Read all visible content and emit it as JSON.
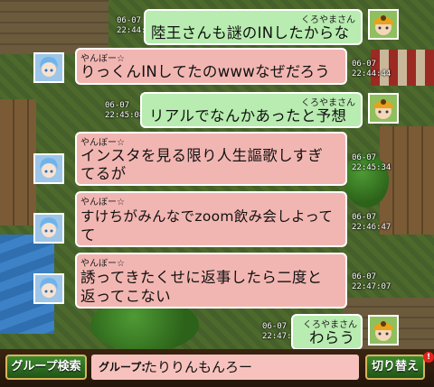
{
  "chat": {
    "messages": [
      {
        "side": "right",
        "sender": "くろやまさん",
        "date": "06-07",
        "time": "22:44:10",
        "lines": [
          "陸王さんも謎のINしたからな"
        ]
      },
      {
        "side": "left",
        "sender": "やんぼー☆",
        "date": "06-07",
        "time": "22:44:44",
        "lines": [
          "りっくんINしてたのwwwなぜだろう"
        ]
      },
      {
        "side": "right",
        "sender": "くろやまさん",
        "date": "06-07",
        "time": "22:45:08",
        "lines": [
          "リアルでなんかあったと予想"
        ]
      },
      {
        "side": "left",
        "sender": "やんぼー☆",
        "date": "06-07",
        "time": "22:45:34",
        "lines": [
          "インスタを見る限り人生謳歌しすぎ",
          "てるが"
        ]
      },
      {
        "side": "left",
        "sender": "やんぼー☆",
        "date": "06-07",
        "time": "22:46:47",
        "lines": [
          "すけちがみんなでzoom飲み会しよって",
          "て"
        ]
      },
      {
        "side": "left",
        "sender": "やんぼー☆",
        "date": "06-07",
        "time": "22:47:07",
        "lines": [
          "誘ってきたくせに返事したら二度と",
          "返ってこない"
        ]
      },
      {
        "side": "right",
        "sender": "くろやまさん",
        "date": "06-07",
        "time": "22:47:19",
        "lines": [
          "わらう"
        ]
      }
    ]
  },
  "bottom_bar": {
    "group_search_label": "グループ検索",
    "group_label": "グループ:",
    "group_name": "たりりんもんろー",
    "switch_label": "切り替え",
    "notification_badge": "!"
  },
  "colors": {
    "left_bubble": "#f2b6b2",
    "right_bubble": "#b8ecb0",
    "button_green": "#2f6e22",
    "button_border": "#d9b45a"
  },
  "icons": [
    "blue-haired-character-avatar-icon",
    "orange-hat-character-avatar-icon"
  ]
}
